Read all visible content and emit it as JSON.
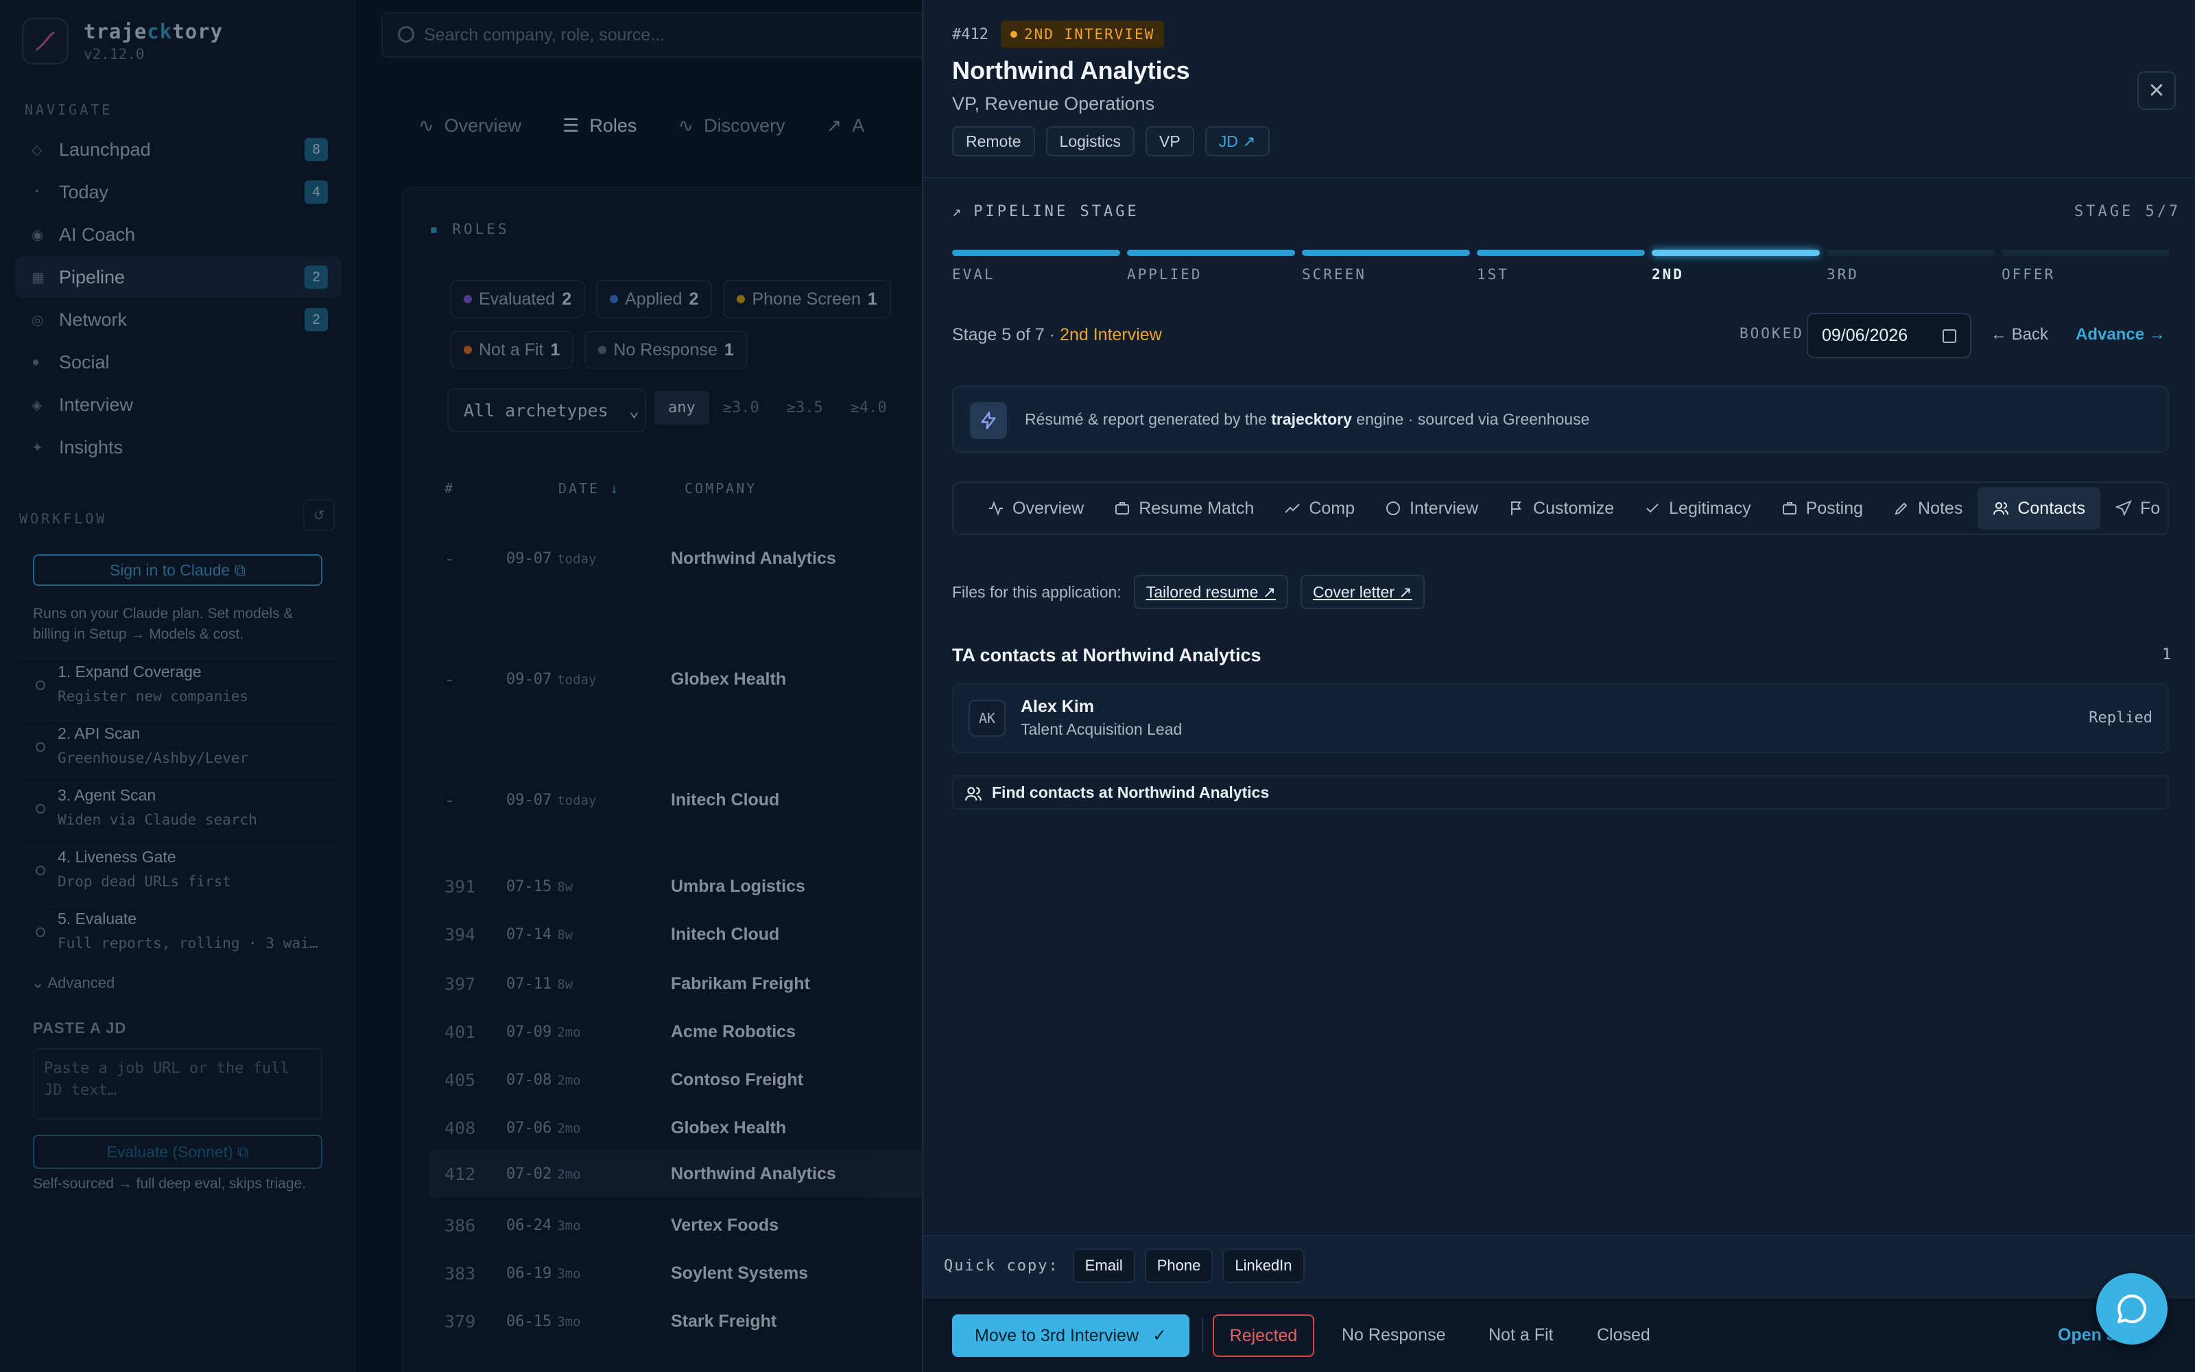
{
  "brand": {
    "name_pre": "traje",
    "name_hl": "ck",
    "name_post": "tory",
    "version": "v2.12.0"
  },
  "sidebar": {
    "navigate_label": "NAVIGATE",
    "items": [
      {
        "label": "Launchpad",
        "badge": "8",
        "icon": "rocket-icon"
      },
      {
        "label": "Today",
        "badge": "4",
        "icon": "clock-icon"
      },
      {
        "label": "AI Coach",
        "badge": "",
        "icon": "target-icon"
      },
      {
        "label": "Pipeline",
        "badge": "2",
        "icon": "grid-icon"
      },
      {
        "label": "Network",
        "badge": "2",
        "icon": "network-icon"
      },
      {
        "label": "Social",
        "badge": "",
        "icon": "social-icon"
      },
      {
        "label": "Interview",
        "badge": "",
        "icon": "diamond-icon"
      },
      {
        "label": "Insights",
        "badge": "",
        "icon": "sparkle-icon"
      }
    ],
    "workflow_label": "WORKFLOW",
    "sign_in": "Sign in to Claude",
    "plan_text": "Runs on your Claude plan. Set models & billing in Setup → Models & cost.",
    "steps": [
      {
        "title": "1. Expand Coverage",
        "sub": "Register new companies"
      },
      {
        "title": "2. API Scan",
        "sub": "Greenhouse/Ashby/Lever"
      },
      {
        "title": "3. Agent Scan",
        "sub": "Widen via Claude search"
      },
      {
        "title": "4. Liveness Gate",
        "sub": "Drop dead URLs first"
      },
      {
        "title": "5. Evaluate",
        "sub": "Full reports, rolling · 3 wai…"
      }
    ],
    "advanced": "Advanced",
    "paste_label": "PASTE A JD",
    "paste_placeholder": "Paste a job URL or the full JD text…",
    "evaluate_btn": "Evaluate (Sonnet)",
    "self_text": "Self-sourced → full deep eval, skips triage."
  },
  "middle": {
    "search_placeholder": "Search company, role, source...",
    "tabs": [
      "Overview",
      "Roles",
      "Discovery",
      "A"
    ],
    "roles_label": "ROLES",
    "chips": [
      {
        "label": "Evaluated",
        "count": "2",
        "color": "#8b5cf6"
      },
      {
        "label": "Applied",
        "count": "2",
        "color": "#3b82f6"
      },
      {
        "label": "Phone Screen",
        "count": "1",
        "color": "#eab308"
      },
      {
        "label": "Not a Fit",
        "count": "1",
        "color": "#f97316"
      },
      {
        "label": "No Response",
        "count": "1",
        "color": "#6b7280"
      }
    ],
    "archetype": "All archetypes",
    "score_filters": [
      "any",
      "≥3.0",
      "≥3.5",
      "≥4.0"
    ],
    "columns": {
      "num": "#",
      "date": "DATE",
      "company": "COMPANY"
    },
    "rows": [
      {
        "num": "-",
        "date": "09-07",
        "age": "today",
        "company": "Northwind Analytics"
      },
      {
        "num": "-",
        "date": "09-07",
        "age": "today",
        "company": "Globex Health"
      },
      {
        "num": "-",
        "date": "09-07",
        "age": "today",
        "company": "Initech Cloud"
      },
      {
        "num": "391",
        "date": "07-15",
        "age": "8w",
        "company": "Umbra Logistics"
      },
      {
        "num": "394",
        "date": "07-14",
        "age": "8w",
        "company": "Initech Cloud"
      },
      {
        "num": "397",
        "date": "07-11",
        "age": "8w",
        "company": "Fabrikam Freight"
      },
      {
        "num": "401",
        "date": "07-09",
        "age": "2mo",
        "company": "Acme Robotics"
      },
      {
        "num": "405",
        "date": "07-08",
        "age": "2mo",
        "company": "Contoso Freight"
      },
      {
        "num": "408",
        "date": "07-06",
        "age": "2mo",
        "company": "Globex Health"
      },
      {
        "num": "412",
        "date": "07-02",
        "age": "2mo",
        "company": "Northwind Analytics"
      },
      {
        "num": "386",
        "date": "06-24",
        "age": "3mo",
        "company": "Vertex Foods"
      },
      {
        "num": "383",
        "date": "06-19",
        "age": "3mo",
        "company": "Soylent Systems"
      },
      {
        "num": "379",
        "date": "06-15",
        "age": "3mo",
        "company": "Stark Freight"
      }
    ]
  },
  "panel": {
    "num": "#412",
    "stage_badge": "2ND INTERVIEW",
    "company": "Northwind Analytics",
    "role": "VP, Revenue Operations",
    "tags": [
      "Remote",
      "Logistics",
      "VP"
    ],
    "jd_link": "JD ↗",
    "pipeline_label": "PIPELINE STAGE",
    "stage_counter": "STAGE 5/7",
    "stages": [
      "EVAL",
      "APPLIED",
      "SCREEN",
      "1ST",
      "2ND",
      "3RD",
      "OFFER"
    ],
    "current_stage_index": 4,
    "stage_text": "Stage 5 of 7 ·",
    "stage_name": "2nd Interview",
    "booked_label": "BOOKED",
    "booked_date": "09/06/2026",
    "back": "← Back",
    "advance": "Advance →",
    "engine_pre": "Résumé & report generated by the",
    "engine_name": "trajecktory",
    "engine_post": "engine · sourced via Greenhouse",
    "tabs": [
      "Overview",
      "Resume Match",
      "Comp",
      "Interview",
      "Customize",
      "Legitimacy",
      "Posting",
      "Notes",
      "Contacts",
      "Fo"
    ],
    "active_tab": "Contacts",
    "files_label": "Files for this application:",
    "file_resume": "Tailored resume ↗",
    "file_cover": "Cover letter ↗",
    "ta_title": "TA contacts at Northwind Analytics",
    "ta_count": "1",
    "contact": {
      "initials": "AK",
      "name": "Alex Kim",
      "role": "Talent Acquisition Lead",
      "status": "Replied"
    },
    "find_contacts": "Find contacts at Northwind Analytics",
    "quick_label": "Quick copy:",
    "quick": [
      "Email",
      "Phone",
      "LinkedIn"
    ],
    "move_btn": "Move to 3rd Interview",
    "rejected": "Rejected",
    "no_response": "No Response",
    "not_fit": "Not a Fit",
    "closed": "Closed",
    "open": "Open J"
  },
  "colors": {
    "accent": "#3ab2e4",
    "warning": "#f0a52c",
    "danger": "#d64545"
  }
}
